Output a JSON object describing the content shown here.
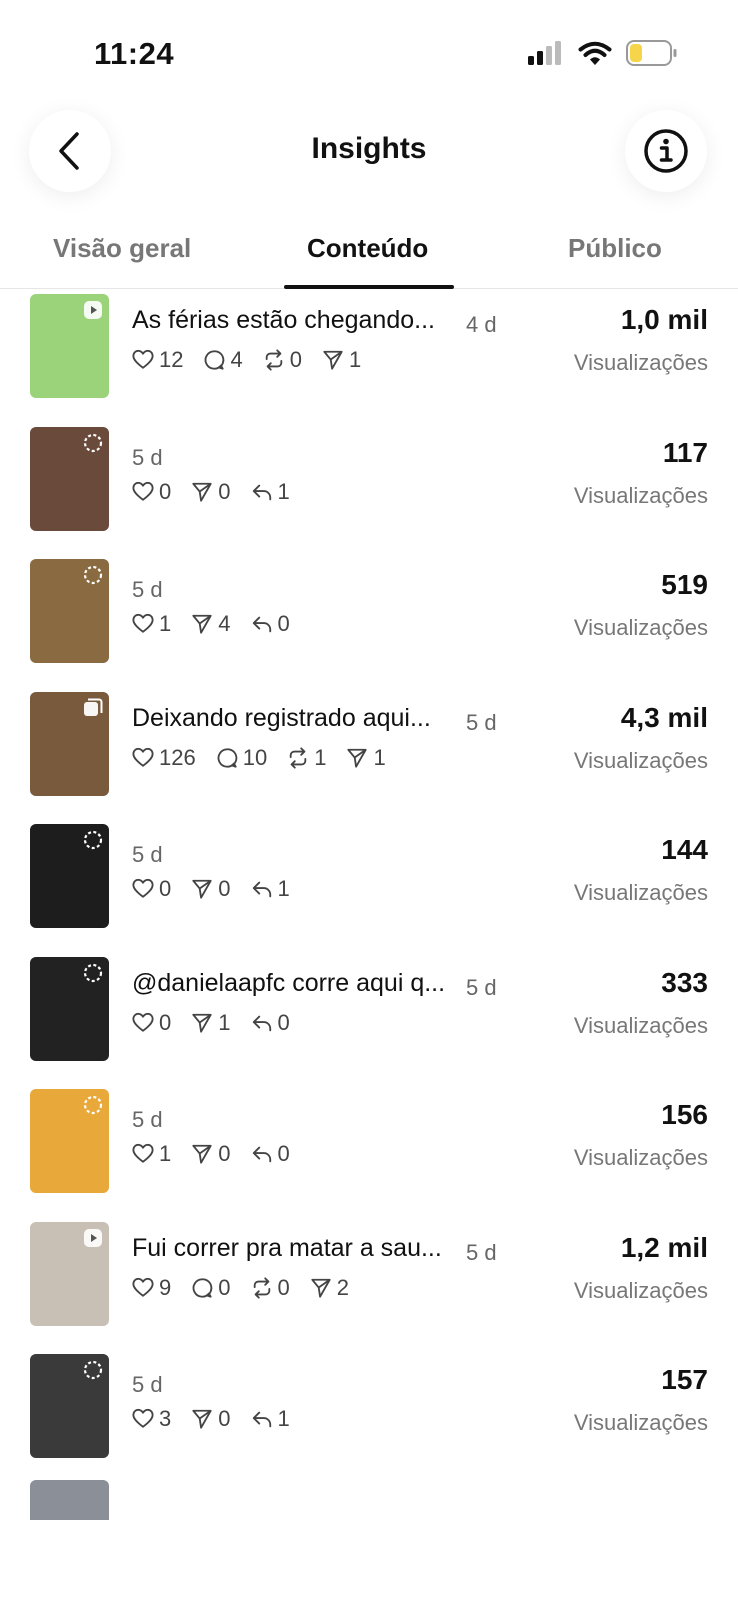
{
  "status_bar": {
    "time": "11:24"
  },
  "header": {
    "title": "Insights"
  },
  "tabs": [
    {
      "label": "Visão geral",
      "active": false
    },
    {
      "label": "Conteúdo",
      "active": true
    },
    {
      "label": "Público",
      "active": false
    }
  ],
  "views_label": "Visualizações",
  "posts": [
    {
      "caption": "As férias estão chegando...",
      "age": "4 d",
      "views": "1,0 mil",
      "thumb_color": "#9bd37a",
      "badge": "play",
      "stats": [
        {
          "icon": "heart-icon",
          "value": "12"
        },
        {
          "icon": "comment-icon",
          "value": "4"
        },
        {
          "icon": "repost-icon",
          "value": "0"
        },
        {
          "icon": "send-icon",
          "value": "1"
        }
      ]
    },
    {
      "caption": "",
      "age": "5 d",
      "views": "117",
      "thumb_color": "#6a4a3a",
      "badge": "story",
      "stats": [
        {
          "icon": "heart-icon",
          "value": "0"
        },
        {
          "icon": "send-icon",
          "value": "0"
        },
        {
          "icon": "reply-icon",
          "value": "1"
        }
      ]
    },
    {
      "caption": "",
      "age": "5 d",
      "views": "519",
      "thumb_color": "#8a6a40",
      "badge": "story",
      "stats": [
        {
          "icon": "heart-icon",
          "value": "1"
        },
        {
          "icon": "send-icon",
          "value": "4"
        },
        {
          "icon": "reply-icon",
          "value": "0"
        }
      ]
    },
    {
      "caption": "Deixando registrado aqui...",
      "age": "5 d",
      "views": "4,3 mil",
      "thumb_color": "#7a5a3c",
      "badge": "carousel",
      "stats": [
        {
          "icon": "heart-icon",
          "value": "126"
        },
        {
          "icon": "comment-icon",
          "value": "10"
        },
        {
          "icon": "repost-icon",
          "value": "1"
        },
        {
          "icon": "send-icon",
          "value": "1"
        }
      ]
    },
    {
      "caption": "",
      "age": "5 d",
      "views": "144",
      "thumb_color": "#1d1d1d",
      "badge": "story",
      "stats": [
        {
          "icon": "heart-icon",
          "value": "0"
        },
        {
          "icon": "send-icon",
          "value": "0"
        },
        {
          "icon": "reply-icon",
          "value": "1"
        }
      ]
    },
    {
      "caption": "@danielaapfc corre aqui q...",
      "age": "5 d",
      "views": "333",
      "thumb_color": "#222222",
      "badge": "story",
      "stats": [
        {
          "icon": "heart-icon",
          "value": "0"
        },
        {
          "icon": "send-icon",
          "value": "1"
        },
        {
          "icon": "reply-icon",
          "value": "0"
        }
      ]
    },
    {
      "caption": "",
      "age": "5 d",
      "views": "156",
      "thumb_color": "#e8a83a",
      "badge": "story",
      "stats": [
        {
          "icon": "heart-icon",
          "value": "1"
        },
        {
          "icon": "send-icon",
          "value": "0"
        },
        {
          "icon": "reply-icon",
          "value": "0"
        }
      ]
    },
    {
      "caption": "Fui correr pra matar a sau...",
      "age": "5 d",
      "views": "1,2 mil",
      "thumb_color": "#c9c0b5",
      "badge": "play",
      "stats": [
        {
          "icon": "heart-icon",
          "value": "9"
        },
        {
          "icon": "comment-icon",
          "value": "0"
        },
        {
          "icon": "repost-icon",
          "value": "0"
        },
        {
          "icon": "send-icon",
          "value": "2"
        }
      ]
    },
    {
      "caption": "",
      "age": "5 d",
      "views": "157",
      "thumb_color": "#3a3a3a",
      "badge": "story",
      "stats": [
        {
          "icon": "heart-icon",
          "value": "3"
        },
        {
          "icon": "send-icon",
          "value": "0"
        },
        {
          "icon": "reply-icon",
          "value": "1"
        }
      ]
    }
  ]
}
